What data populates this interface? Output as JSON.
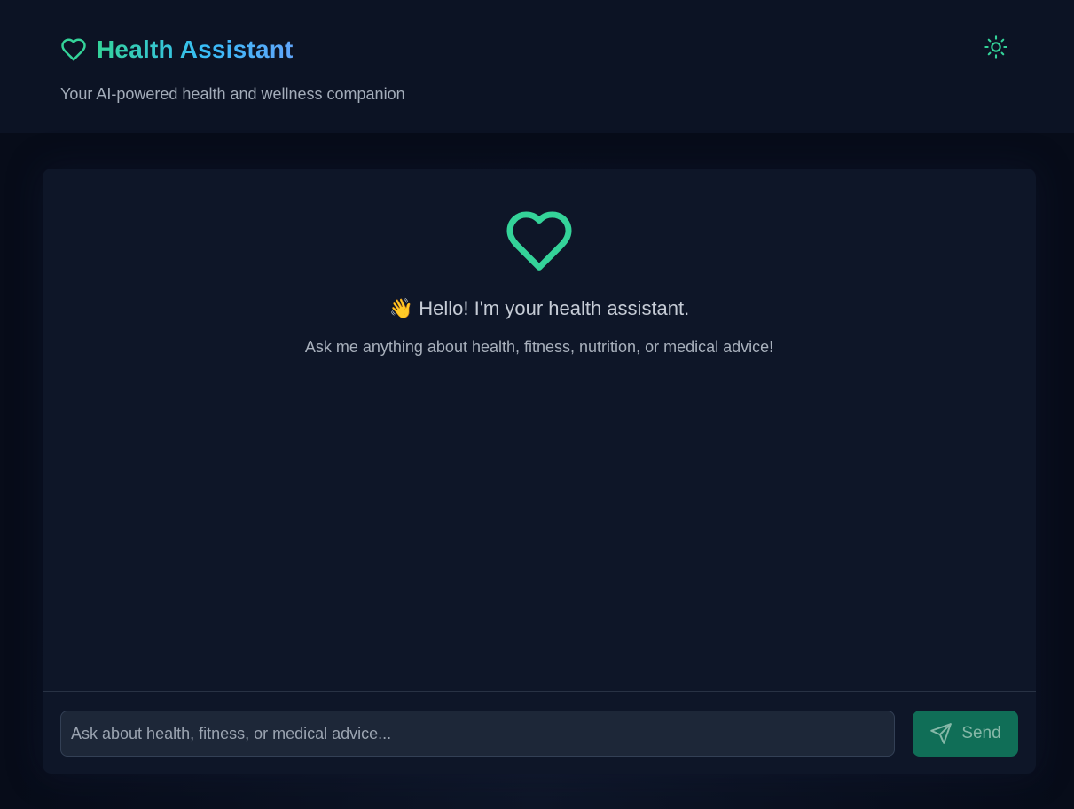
{
  "header": {
    "title": "Health Assistant",
    "subtitle": "Your AI-powered health and wellness companion",
    "brand_icon": "heart-outline-icon",
    "theme_toggle_icon": "sun-icon"
  },
  "welcome": {
    "icon": "heart-outline-icon",
    "wave_emoji": "👋",
    "title": "Hello! I'm your health assistant.",
    "subtitle": "Ask me anything about health, fitness, nutrition, or medical advice!"
  },
  "composer": {
    "placeholder": "Ask about health, fitness, or medical advice...",
    "value": "",
    "send_label": "Send",
    "send_icon": "send-icon"
  },
  "colors": {
    "accent": "#34d399",
    "title_gradient_start": "#34d399",
    "title_gradient_end": "#60a5fa",
    "header_bg": "#0c1324",
    "card_bg": "#0e1628",
    "send_button_bg": "#106e57"
  }
}
